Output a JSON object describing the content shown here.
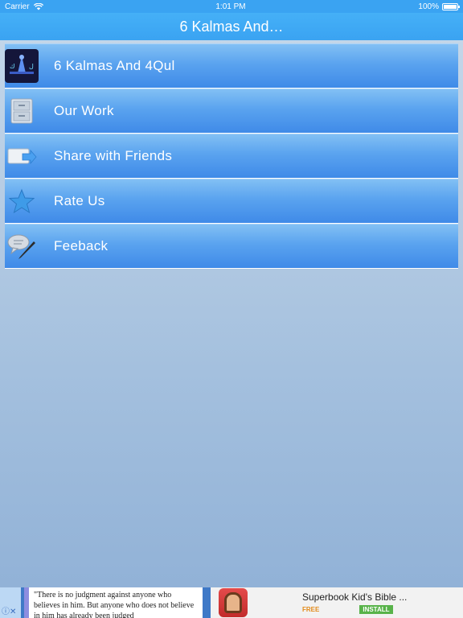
{
  "status_bar": {
    "carrier": "Carrier",
    "time": "1:01 PM",
    "battery": "100%"
  },
  "nav": {
    "title": "6 Kalmas And…"
  },
  "menu": {
    "items": [
      {
        "label": "6 Kalmas And 4Qul",
        "icon": "app-logo-icon"
      },
      {
        "label": "Our Work",
        "icon": "drawers-icon"
      },
      {
        "label": "Share with Friends",
        "icon": "share-arrow-icon"
      },
      {
        "label": "Rate Us",
        "icon": "star-icon"
      },
      {
        "label": "Feeback",
        "icon": "chat-pen-icon"
      }
    ]
  },
  "ad": {
    "close_glyph": "ⓘ✕",
    "quote": "\"There is no judgment against anyone who believes in him. But anyone who does not believe in him has already been judged",
    "app_title": "Superbook Kid's Bible ...",
    "price": "FREE",
    "install_label": "INSTALL"
  },
  "colors": {
    "nav_bar": "#3aa3f2",
    "menu_item": "#5aa3ef",
    "background": "#b7cde4"
  }
}
